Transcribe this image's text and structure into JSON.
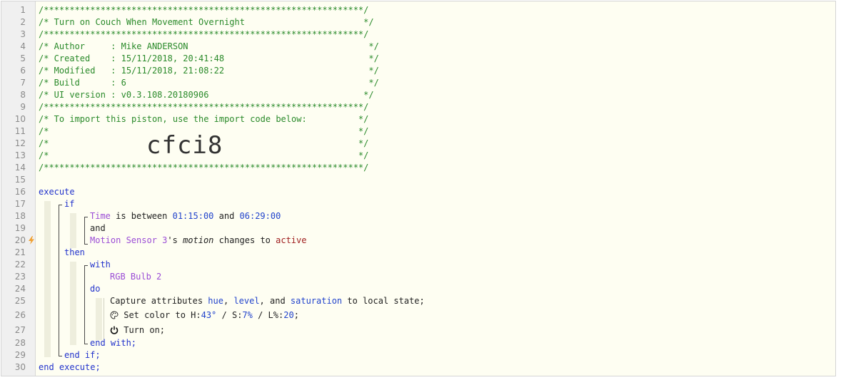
{
  "gutter": {
    "line_numbers": [
      "1",
      "2",
      "3",
      "4",
      "5",
      "6",
      "7",
      "8",
      "9",
      "10",
      "11",
      "12",
      "13",
      "14",
      "15",
      "16",
      "17",
      "18",
      "19",
      "20",
      "21",
      "22",
      "23",
      "24",
      "25",
      "26",
      "27",
      "28",
      "29",
      "30"
    ]
  },
  "header": {
    "stars": "/**************************************************************/",
    "title": "/* Turn on Couch When Movement Overnight                       */",
    "author": "/* Author     : Mike ANDERSON                                   */",
    "created": "/* Created    : 15/11/2018, 20:41:48                            */",
    "modified": "/* Modified   : 15/11/2018, 21:08:22                            */",
    "build": "/* Build      : 6                                               */",
    "ui_version": "/* UI version : v0.3.108.20180906                              */",
    "import_note": "/* To import this piston, use the import code below:          */",
    "blank_comment": "/*                                                            */",
    "import_code": "cfci8"
  },
  "code": {
    "execute": "execute",
    "if": "if",
    "time": "Time",
    "is_between": " is between ",
    "t1": "01:15:00",
    "and_word": " and ",
    "t2": "06:29:00",
    "and_line": "and",
    "motion_device": "Motion Sensor 3",
    "possessive": "'s ",
    "motion_attr": "motion",
    "changes_to": " changes to ",
    "active": "active",
    "then": "then",
    "with": "with",
    "rgb_device": "RGB Bulb 2",
    "do": "do",
    "capture_pre": "Capture attributes ",
    "hue": "hue",
    "comma1": ", ",
    "level": "level",
    "comma2": ", and ",
    "saturation": "saturation",
    "capture_post": " to local state;",
    "set_color_pre": "Set color to H:",
    "h_val": "43°",
    "s_pre": " / S:",
    "s_val": "7%",
    "l_pre": " / L%:",
    "l_val": "20",
    "semi": ";",
    "turn_on": "Turn on;",
    "end_with": "end with;",
    "end_if": "end if;",
    "end_execute": "end execute;"
  },
  "icons": {
    "trigger_marker": "lightning-bolt-icon",
    "palette": "palette-icon",
    "power": "power-icon"
  },
  "colors": {
    "comment": "#2a8a2a",
    "keyword": "#2233cc",
    "device": "#9b4cd6",
    "value": "#2244cc",
    "active": "#a02020",
    "editor_bg": "#fefef2"
  }
}
